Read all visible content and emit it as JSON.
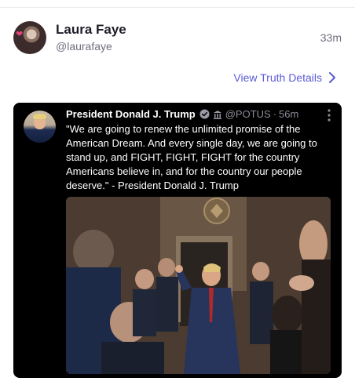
{
  "post": {
    "author_name": "Laura Faye",
    "author_handle": "@laurafaye",
    "time": "33m",
    "view_details": "View Truth Details"
  },
  "embed": {
    "author_name": "President Donald J. Trump",
    "handle": "@POTUS",
    "separator": "·",
    "time": "56m",
    "text": "\"We are going to renew the unlimited promise of the American Dream. And every single day, we are going to stand up, and FIGHT, FIGHT, FIGHT for the country Americans believe in, and for the country our people deserve.\" - President Donald J. Trump"
  },
  "colors": {
    "accent": "#5b5bd6",
    "card_bg": "#000000",
    "name": "#1e1e2a",
    "muted": "#6e6e7e"
  },
  "icons": {
    "avatar": "avatar",
    "view_details": "chevron-right-icon",
    "verified": "verified-badge-icon",
    "government": "government-building-icon",
    "more": "more-vertical-icon"
  }
}
